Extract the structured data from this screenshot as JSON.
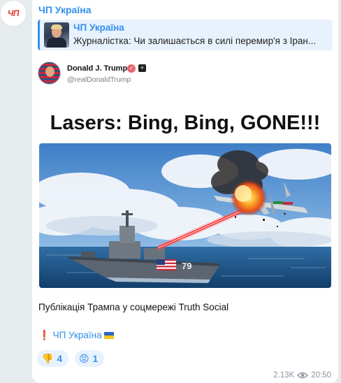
{
  "channel": {
    "avatar_text": "ЧП",
    "name": "ЧП Україна"
  },
  "reply": {
    "title": "ЧП Україна",
    "text": "Журналістка: Чи залишається в силі перемир'я з Іран..."
  },
  "post": {
    "author_name": "Donald J. Trump",
    "author_handle": "@realDonaldTrump",
    "headline": "Lasers: Bing, Bing, GONE!!!",
    "ship_number": "79"
  },
  "caption": "Публікація Трампа у соцмережі Truth Social",
  "signature": {
    "exclamation": "❗",
    "name": "ЧП Україна"
  },
  "reactions": [
    {
      "emoji": "👎",
      "count": "4"
    },
    {
      "emoji": "😡",
      "count": "1"
    }
  ],
  "meta": {
    "views": "2.13K",
    "time": "20:50"
  },
  "colors": {
    "accent": "#3390ec",
    "background": "#e6ebee",
    "laser": "#ff2a2a"
  }
}
